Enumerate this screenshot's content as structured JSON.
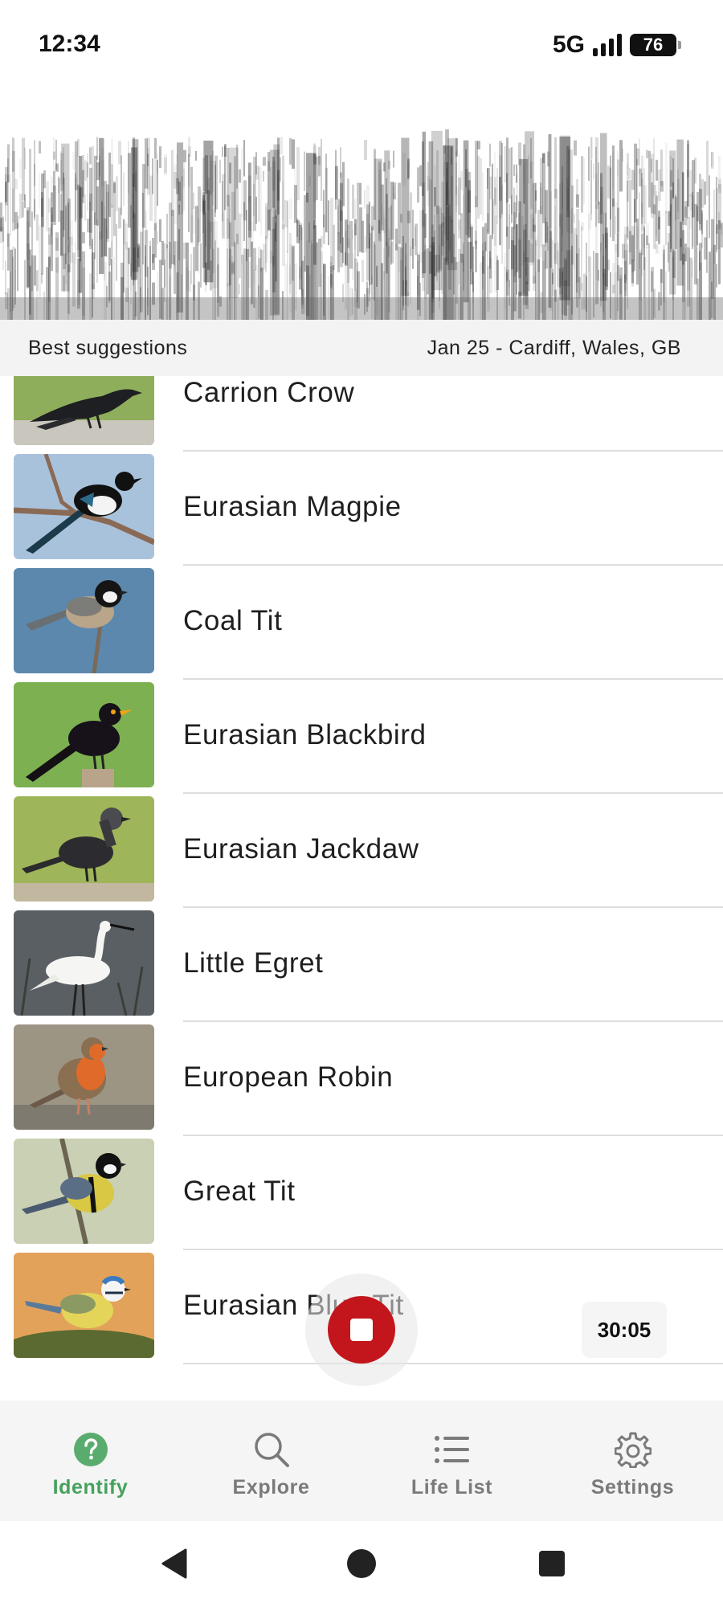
{
  "status_bar": {
    "time": "12:34",
    "network": "5G",
    "battery": "76"
  },
  "header": {
    "title": "Best suggestions",
    "meta": "Jan 25 - Cardiff, Wales, GB"
  },
  "species": [
    {
      "name": "Carrion Crow",
      "image": "carrion-crow-photo"
    },
    {
      "name": "Eurasian Magpie",
      "image": "eurasian-magpie-photo"
    },
    {
      "name": "Coal Tit",
      "image": "coal-tit-photo"
    },
    {
      "name": "Eurasian Blackbird",
      "image": "eurasian-blackbird-photo"
    },
    {
      "name": "Eurasian Jackdaw",
      "image": "eurasian-jackdaw-photo"
    },
    {
      "name": "Little Egret",
      "image": "little-egret-photo"
    },
    {
      "name": "European Robin",
      "image": "european-robin-photo"
    },
    {
      "name": "Great Tit",
      "image": "great-tit-photo"
    },
    {
      "name": "Eurasian Blue Tit",
      "image": "eurasian-blue-tit-photo"
    }
  ],
  "recorder": {
    "timer": "30:05",
    "state": "recording",
    "icon": "stop-icon",
    "color": "#c3161c"
  },
  "bottom_nav": [
    {
      "label": "Identify",
      "icon": "question-circle-icon",
      "active": true
    },
    {
      "label": "Explore",
      "icon": "search-icon",
      "active": false
    },
    {
      "label": "Life List",
      "icon": "list-icon",
      "active": false
    },
    {
      "label": "Settings",
      "icon": "gear-icon",
      "active": false
    }
  ],
  "colors": {
    "accent": "#46a15d",
    "record": "#c3161c",
    "header_bg": "#f2f3f2"
  }
}
